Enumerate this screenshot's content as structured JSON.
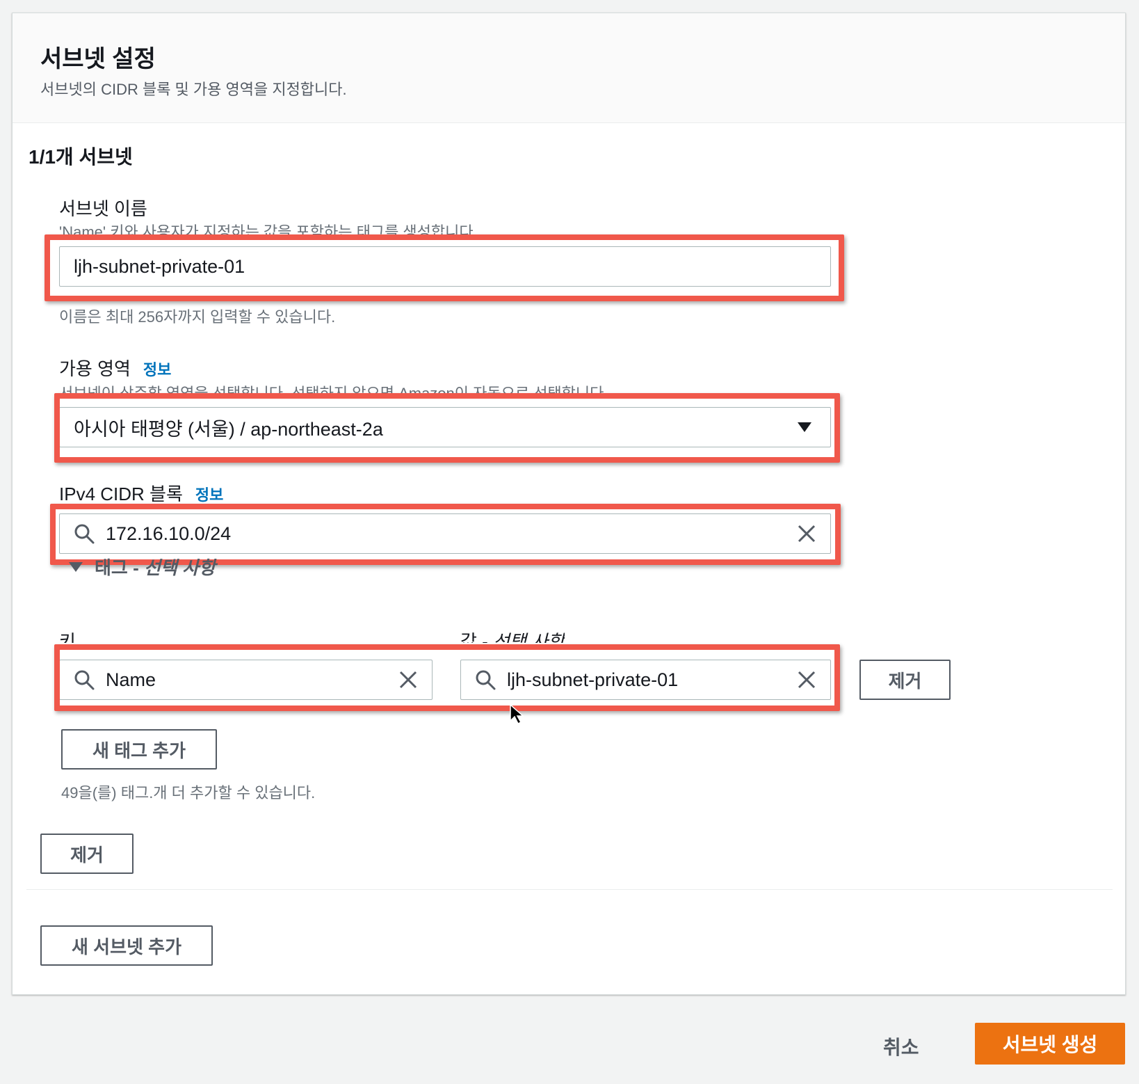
{
  "header": {
    "title": "서브넷 설정",
    "description": "서브넷의 CIDR 블록 및 가용 영역을 지정합니다."
  },
  "subnet": {
    "count_title": "1/1개 서브넷",
    "name": {
      "label": "서브넷 이름",
      "description": "'Name' 키와 사용자가 지정하는 값을 포함하는 태그를 생성합니다.",
      "value": "ljh-subnet-private-01",
      "constraint": "이름은 최대 256자까지 입력할 수 있습니다."
    },
    "availability_zone": {
      "label": "가용 영역",
      "info": "정보",
      "description": "서브넷이 상주할 영역을 선택합니다. 선택하지 않으면 Amazon이 자동으로 선택합니다.",
      "selected": "아시아 태평양 (서울) / ap-northeast-2a"
    },
    "ipv4_cidr": {
      "label": "IPv4 CIDR 블록",
      "info": "정보",
      "value": "172.16.10.0/24"
    },
    "tags": {
      "toggle_label": "태그 - ",
      "toggle_optional": "선택 사항",
      "key_label": "키",
      "value_label": "값 - ",
      "value_optional": "선택 사항",
      "key_value": "Name",
      "value_value": "ljh-subnet-private-01",
      "remove_label": "제거",
      "add_label": "새 태그 추가",
      "remaining": "49을(를) 태그.개 더 추가할 수 있습니다."
    },
    "remove_subnet_label": "제거"
  },
  "add_subnet_label": "새 서브넷 추가",
  "footer": {
    "cancel_label": "취소",
    "create_label": "서브넷 생성"
  },
  "colors": {
    "primary": "#ec7211",
    "link": "#0073bb",
    "highlight": "#f0584b"
  }
}
